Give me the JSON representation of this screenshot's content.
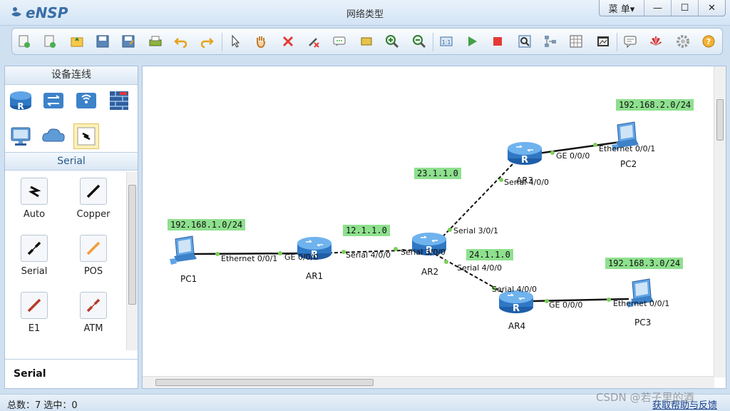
{
  "window": {
    "app_name": "eNSP",
    "title": "网络类型",
    "menu_label": "菜 单▾",
    "minimize": "—",
    "maximize": "☐",
    "close": "✕"
  },
  "toolbar": {
    "icons": [
      "new-topo-icon",
      "new-exam-icon",
      "open-icon",
      "save-icon",
      "save-as-icon",
      "print-icon",
      "undo-icon",
      "redo-icon",
      "select-icon",
      "pan-hand-icon",
      "delete-icon",
      "delete-link-icon",
      "add-text-icon",
      "add-shape-icon",
      "zoom-in-icon",
      "zoom-out-icon",
      "fit-icon",
      "start-all-icon",
      "stop-all-icon",
      "capture-icon",
      "topology-icon",
      "grid-icon",
      "screenshot-icon",
      "chat-icon",
      "huawei-icon",
      "settings-icon",
      "help-icon"
    ]
  },
  "left_panel": {
    "header": "设备连线",
    "subheader": "Serial",
    "categories": [
      "router-icon",
      "switch-icon",
      "wlan-icon",
      "firewall-icon",
      "pc-icon",
      "cloud-icon",
      "cable-icon"
    ],
    "cables": [
      {
        "label": "Auto",
        "icon": "auto-cable-icon",
        "color": "#222222"
      },
      {
        "label": "Copper",
        "icon": "copper-cable-icon",
        "color": "#111111"
      },
      {
        "label": "Serial",
        "icon": "serial-cable-icon",
        "color": "#111111"
      },
      {
        "label": "POS",
        "icon": "pos-cable-icon",
        "color": "#f39c3a"
      },
      {
        "label": "E1",
        "icon": "e1-cable-icon",
        "color": "#b83a2a"
      },
      {
        "label": "ATM",
        "icon": "atm-cable-icon",
        "color": "#b83a2a"
      }
    ],
    "selected_label": "Serial"
  },
  "topology": {
    "networks": [
      {
        "text": "192.168.1.0/24"
      },
      {
        "text": "12.1.1.0"
      },
      {
        "text": "23.1.1.0"
      },
      {
        "text": "24.1.1.0"
      },
      {
        "text": "192.168.2.0/24"
      },
      {
        "text": "192.168.3.0/24"
      }
    ],
    "devices": [
      {
        "name": "PC1",
        "type": "pc"
      },
      {
        "name": "AR1",
        "type": "router"
      },
      {
        "name": "AR2",
        "type": "router"
      },
      {
        "name": "AR3",
        "type": "router"
      },
      {
        "name": "AR4",
        "type": "router"
      },
      {
        "name": "PC2",
        "type": "pc"
      },
      {
        "name": "PC3",
        "type": "pc"
      }
    ],
    "ports": [
      {
        "text": "Ethernet 0/0/1"
      },
      {
        "text": "GE 0/0/0"
      },
      {
        "text": "Serial 4/0/0"
      },
      {
        "text": "Serial 3/0/0"
      },
      {
        "text": "Serial 3/0/1"
      },
      {
        "text": "Serial 4/0/0"
      },
      {
        "text": "GE 0/0/0"
      },
      {
        "text": "Ethernet 0/0/1"
      },
      {
        "text": "Serial 4/0/0"
      },
      {
        "text": "Serial 4/0/0"
      },
      {
        "text": "GE 0/0/0"
      },
      {
        "text": "Ethernet 0/0/1"
      }
    ]
  },
  "status": {
    "text": "总数：7  选中：0",
    "help_link": "获取帮助与反馈"
  },
  "watermark": "CSDN @若子里的酒"
}
